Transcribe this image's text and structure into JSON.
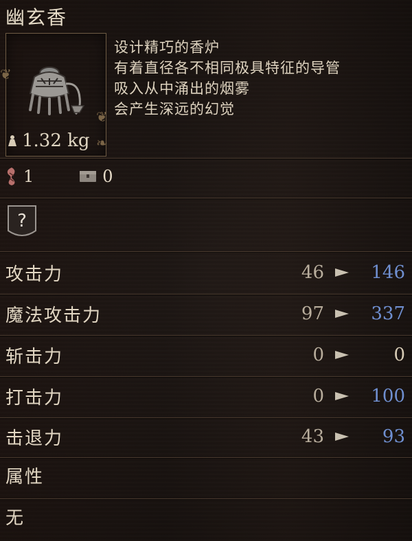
{
  "item": {
    "name": "幽玄香",
    "weight": "1.32 kg",
    "description": [
      "设计精巧的香炉",
      "有着直径各不相同极具特征的导管",
      "吸入从中涌出的烟雾",
      "会产生深远的幻觉"
    ]
  },
  "counts": {
    "owned": "1",
    "stored": "0"
  },
  "badge": {
    "symbol": "?"
  },
  "stats": [
    {
      "label": "攻击力",
      "current": "46",
      "new": "146",
      "new_color": "#6f8fd0"
    },
    {
      "label": "魔法攻击力",
      "current": "97",
      "new": "337",
      "new_color": "#6f8fd0"
    },
    {
      "label": "斩击力",
      "current": "0",
      "new": "0",
      "new_color": "#d8ccb6"
    },
    {
      "label": "打击力",
      "current": "0",
      "new": "100",
      "new_color": "#6f8fd0"
    },
    {
      "label": "击退力",
      "current": "43",
      "new": "93",
      "new_color": "#6f8fd0"
    }
  ],
  "attributes": {
    "header": "属性",
    "value": "无"
  },
  "colors": {
    "accent_blue": "#6f8fd0",
    "text": "#d8ccb6"
  }
}
